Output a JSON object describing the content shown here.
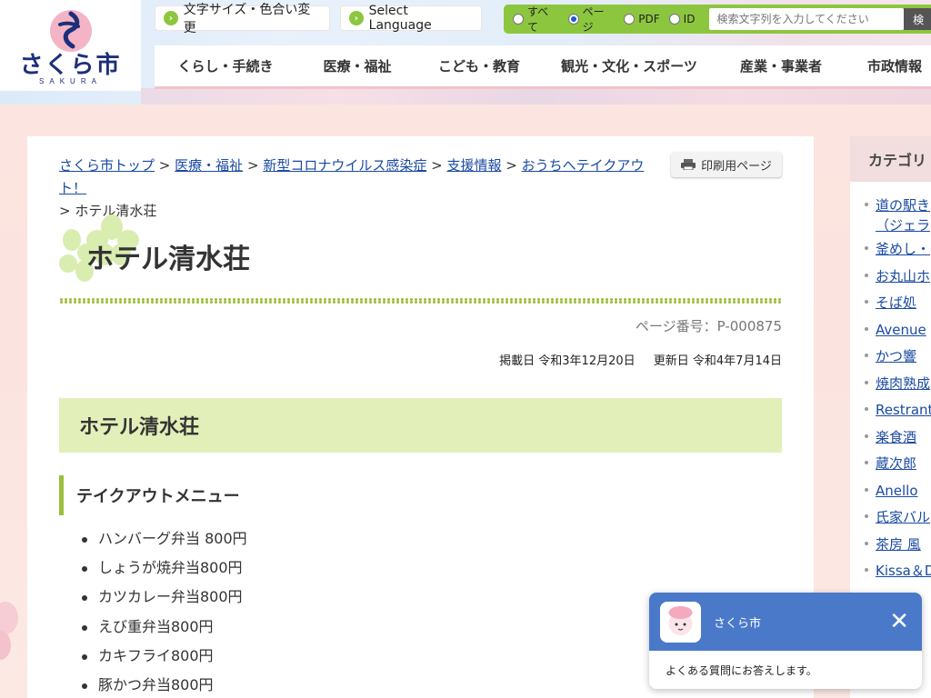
{
  "header": {
    "logo_text": "さくら市",
    "logo_sub": "SAKURA",
    "text_size_label": "文字サイズ・色合い変更",
    "language_label": "Select Language",
    "search_scopes": [
      "すべて",
      "ページ",
      "PDF",
      "ID"
    ],
    "search_selected": "ページ",
    "search_placeholder": "検索文字列を入力してください",
    "search_button": "検"
  },
  "gnav": [
    "くらし・手続き",
    "医療・福祉",
    "こども・教育",
    "観光・文化・スポーツ",
    "産業・事業者",
    "市政情報"
  ],
  "breadcrumb": {
    "links": [
      "さくら市トップ",
      "医療・福祉",
      "新型コロナウイルス感染症",
      "支援情報",
      "おうちへテイクアウト！"
    ],
    "separator": ">",
    "current": "ホテル清水荘"
  },
  "print_label": "印刷用ページ",
  "page": {
    "title": "ホテル清水荘",
    "page_number": "ページ番号：P-000875",
    "published": "掲載日 令和3年12月20日",
    "updated": "更新日 令和4年7月14日",
    "h2": "ホテル清水荘",
    "h3": "テイクアウトメニュー",
    "menu": [
      "ハンバーグ弁当 800円",
      "しょうが焼弁当800円",
      "カツカレー弁当800円",
      "えび重弁当800円",
      "カキフライ800円",
      "豚かつ弁当800円"
    ]
  },
  "side": {
    "heading": "カテゴリ",
    "items": [
      "道の駅き",
      "（ジェラ",
      "釜めし・",
      "お丸山ホ",
      "そば処",
      "Avenue",
      "かつ響",
      "焼肉熟成",
      "Restrant",
      "楽食酒",
      "蔵次郎",
      "Anello",
      "氏家バル",
      "茶房 風",
      "Kissa＆D"
    ]
  },
  "chat": {
    "title": "さくら市",
    "message": "よくある質問にお答えします。",
    "close": "✕"
  },
  "colors": {
    "accent_green": "#8cc63f",
    "nav_blue": "#4a79c9",
    "link": "#1a4aa3"
  }
}
